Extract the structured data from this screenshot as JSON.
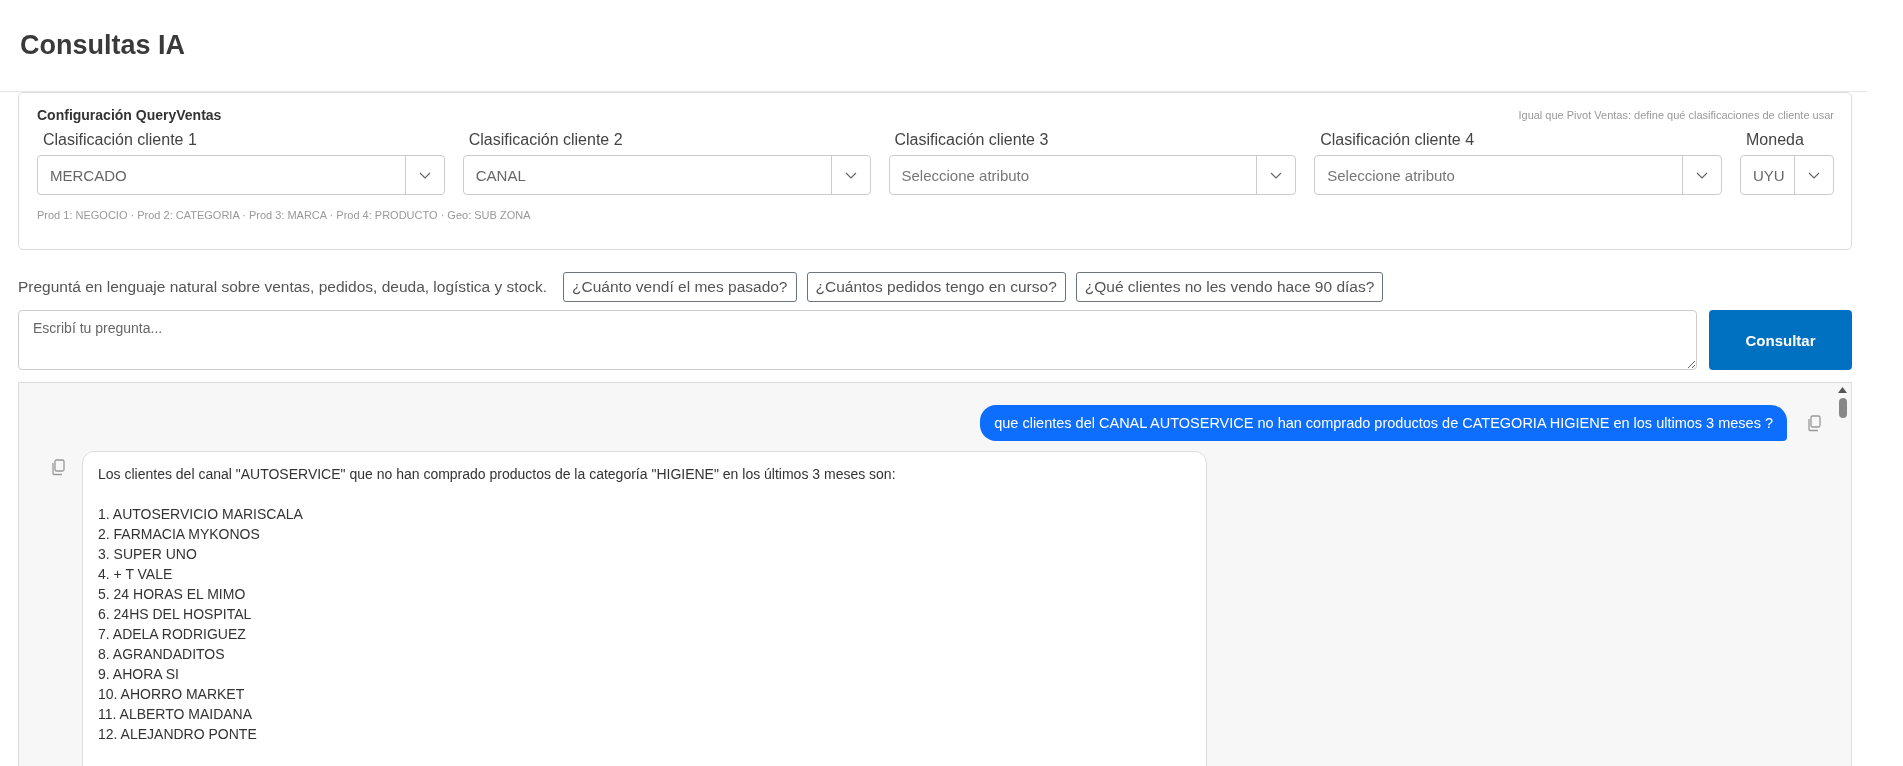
{
  "page": {
    "title": "Consultas IA"
  },
  "config": {
    "title": "Configuración QueryVentas",
    "hint": "Igual que Pivot Ventas: define qué clasificaciones de cliente usar",
    "selects": [
      {
        "label": "Clasificación cliente 1",
        "value": "MERCADO",
        "kind": "wide"
      },
      {
        "label": "Clasificación cliente 2",
        "value": "CANAL",
        "kind": "wide"
      },
      {
        "label": "Clasificación cliente 3",
        "placeholder": "Seleccione atributo",
        "kind": "wide"
      },
      {
        "label": "Clasificación cliente 4",
        "placeholder": "Seleccione atributo",
        "kind": "wide"
      },
      {
        "label": "Moneda",
        "value": "UYU",
        "kind": "narrow"
      }
    ],
    "note": "Prod 1: NEGOCIO · Prod 2: CATEGORIA · Prod 3: MARCA · Prod 4: PRODUCTO · Geo: SUB ZONA"
  },
  "prompt": {
    "intro": "Preguntá en lenguaje natural sobre ventas, pedidos, deuda, logística y stock.",
    "suggestions": [
      "¿Cuánto vendí el mes pasado?",
      "¿Cuántos pedidos tengo en curso?",
      "¿Qué clientes no les vendo hace 90 días?"
    ],
    "placeholder": "Escribí tu pregunta...",
    "submit": "Consultar"
  },
  "chat": {
    "messages": [
      {
        "kind": "user",
        "text": "que clientes del CANAL AUTOSERVICE no han comprado productos de CATEGORIA HIGIENE en los ultimos 3 meses ?"
      },
      {
        "kind": "assistant",
        "text": "Los clientes del canal \"AUTOSERVICE\" que no han comprado productos de la categoría \"HIGIENE\" en los últimos 3 meses son:",
        "items": [
          "1. AUTOSERVICIO MARISCALA",
          "2. FARMACIA MYKONOS",
          "3. SUPER UNO",
          "4. + T VALE",
          "5. 24 HORAS EL MIMO",
          "6. 24HS DEL HOSPITAL",
          "7. ADELA RODRIGUEZ",
          "8. AGRANDADITOS",
          "9. AHORA SI",
          "10. AHORRO MARKET",
          "11. ALBERTO MAIDANA",
          "12. ALEJANDRO PONTE"
        ]
      }
    ]
  }
}
